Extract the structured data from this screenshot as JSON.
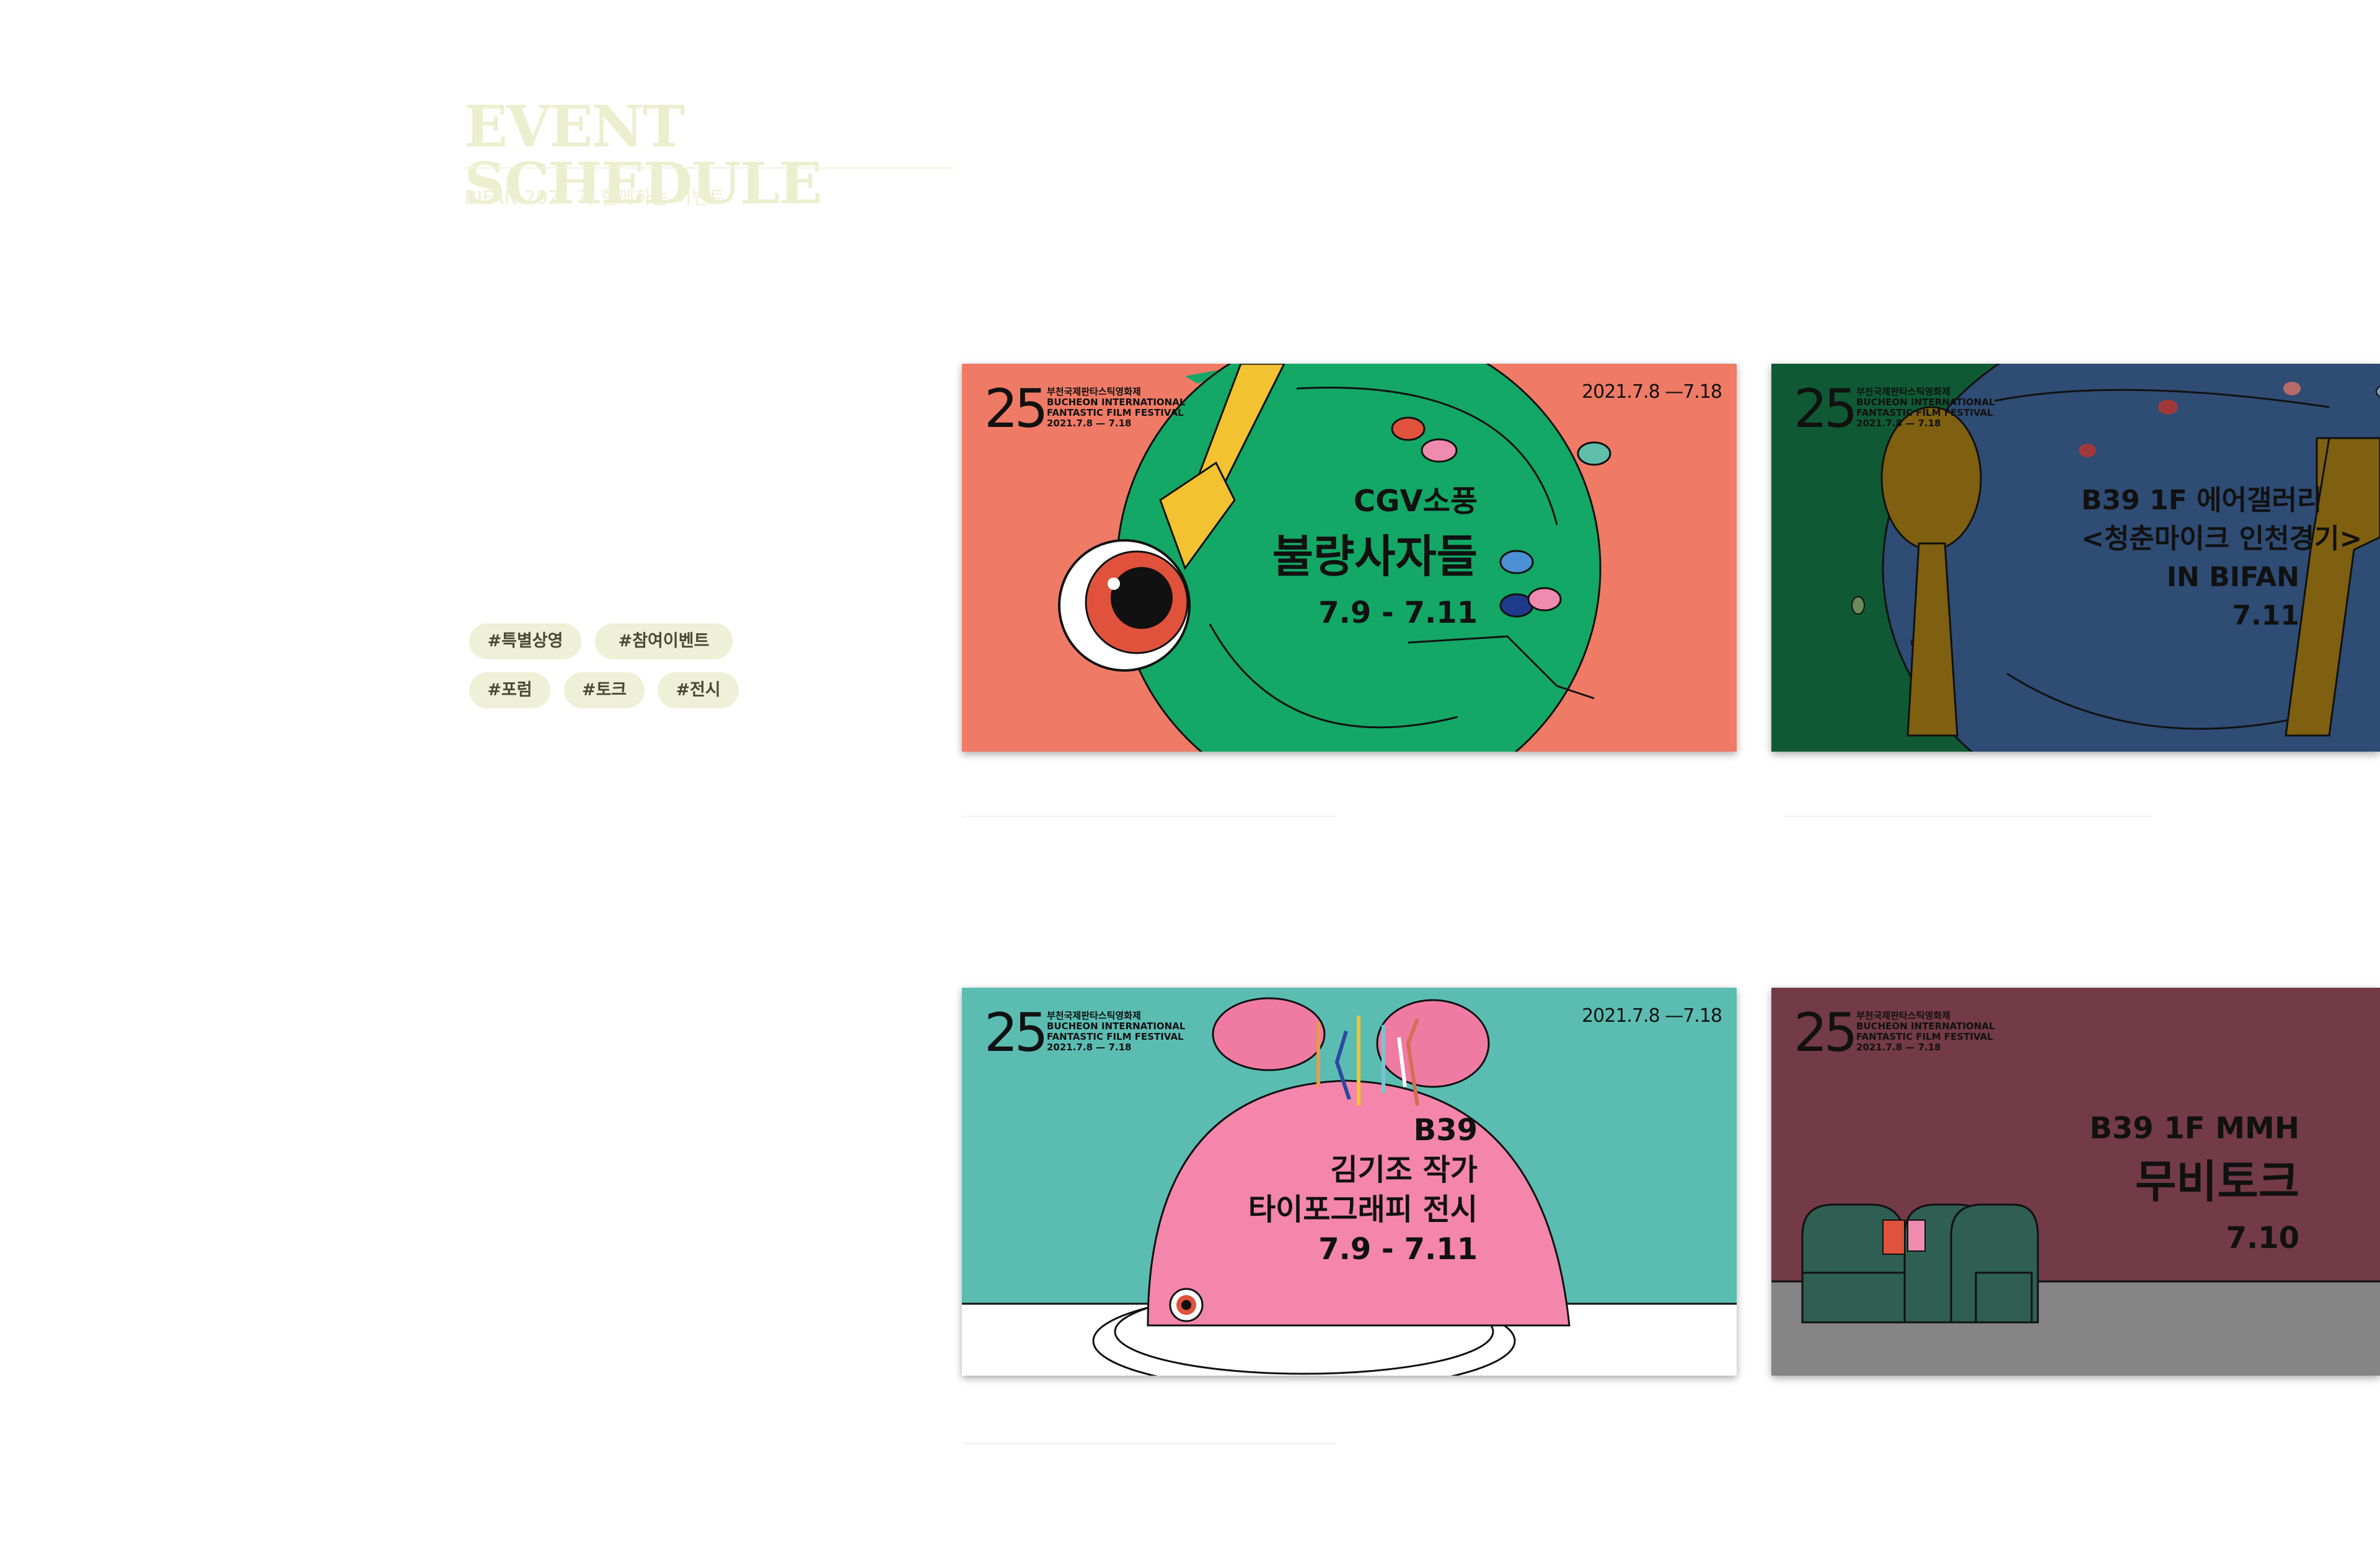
{
  "header": {
    "title": "EVENT SCHEDULE",
    "subtitle": "BIFAN 2021 과 함께하는 이벤트"
  },
  "tags": [
    "#특별상영",
    "#참여이벤트",
    "#포럼",
    "#토크",
    "#전시"
  ],
  "logo": {
    "number": "25",
    "text": "부천국제판타스틱영화제\nBUCHEON INTERNATIONAL\nFANTASTIC FILM FESTIVAL\n2021.7.8 — 7.18"
  },
  "cards": [
    {
      "date": "2021.7.8 —7.18",
      "line1": "CGV소풍",
      "line2": "불량사자들",
      "line3": "7.9 - 7.11",
      "bg": "#ef7b66"
    },
    {
      "line1": "B39 1F 에어갤러리",
      "line2": "<청춘마이크 인천경기>",
      "line3": "IN BIFAN",
      "line4": "7.11",
      "bg": "#0f5a35"
    },
    {
      "date": "2021.7.8 —7.18",
      "line1": "B39",
      "line2": "김기조 작가",
      "line3": "타이포그래피 전시",
      "line4": "7.9 - 7.11",
      "bg": "#5bbdb2"
    },
    {
      "line1": "B39 1F MMH",
      "line2": "무비토크",
      "line3": "7.10",
      "bg": "#733a47"
    }
  ]
}
